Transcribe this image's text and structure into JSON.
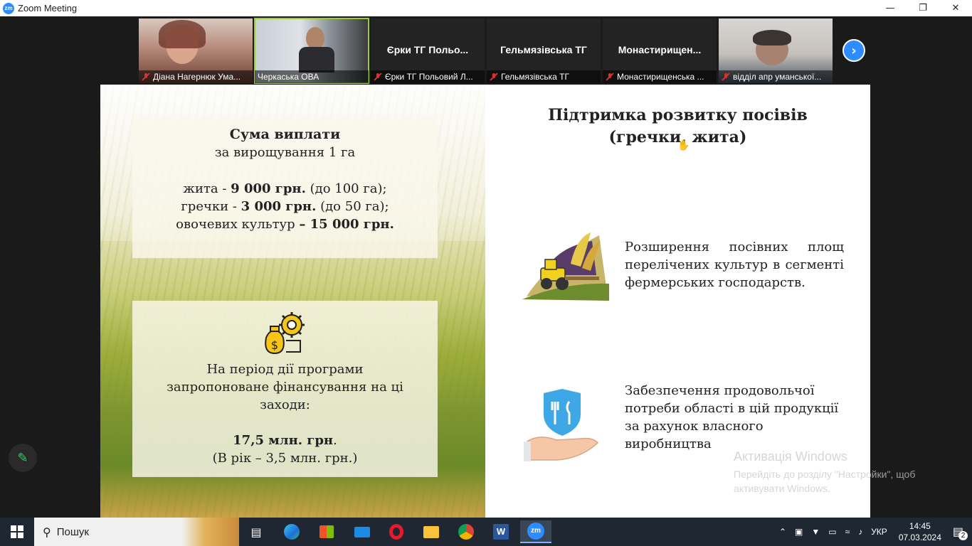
{
  "window": {
    "app_logo": "zm",
    "title": "Zoom Meeting",
    "controls": [
      "minimize-icon",
      "restore-icon",
      "close-icon"
    ]
  },
  "participants": [
    {
      "label": "Діана Нагернюк Ума...",
      "muted": true,
      "video": true
    },
    {
      "label": "Черкаська ОВА",
      "muted": false,
      "video": true,
      "active_speaker": true
    },
    {
      "name": "Єрки ТГ Польо...",
      "label": "Єрки ТГ Польовий Л...",
      "muted": true,
      "video": false
    },
    {
      "name": "Гельмязівська ТГ",
      "label": "Гельмязівська ТГ",
      "muted": true,
      "video": false
    },
    {
      "name": "Монастирищен...",
      "label": "Монастирищенська ...",
      "muted": true,
      "video": false
    },
    {
      "label": "відділ апр уманської...",
      "muted": true,
      "video": true
    }
  ],
  "slide": {
    "card1": {
      "heading": "Сума виплати",
      "subheading": "за вирощування  1 га",
      "rye_prefix": "жита - ",
      "rye_amount": "9 000 грн.",
      "rye_suffix": " (до 100 га);",
      "buckwheat_prefix": "гречки - ",
      "buckwheat_amount": "3 000 грн.",
      "buckwheat_suffix": " (до 50 га);",
      "veg_prefix": "овочевих культур ",
      "veg_amount": "– 15 000 грн."
    },
    "card2": {
      "line1": "На період дії програми",
      "line2": "запропоноване  фінансування на ці",
      "line3": "заходи:",
      "amount": "17,5 млн. грн",
      "amount_suffix": ".",
      "per_year": "(В рік – 3,5 млн. грн.)"
    },
    "title_line1": "Підтримка розвитку посівів",
    "title_line2": "(гречки, жита)",
    "item1": "Розширення посівних площ перелічених культур в сегменті фермерських господарств.",
    "item2": "Забезпечення продовольчої потреби області в цій продукції за рахунок власного виробництва"
  },
  "watermark": {
    "line1": "Активація Windows",
    "line2": "Перейдіть до розділу \"Настройки\", щоб",
    "line3": "активувати Windows."
  },
  "taskbar": {
    "search_placeholder": "Пошук",
    "apps": [
      "task-view-icon",
      "edge-icon",
      "store-icon",
      "mail-icon",
      "opera-icon",
      "explorer-icon",
      "chrome-icon",
      "word-icon",
      "zoom-icon"
    ],
    "lang": "УКР",
    "time": "14:45",
    "date": "07.03.2024",
    "notifications": "2"
  },
  "colors": {
    "zoom_blue": "#2d8cff",
    "muted_red": "#e0302b",
    "active_speaker": "#9acd32",
    "taskbar": "#1f2733"
  }
}
